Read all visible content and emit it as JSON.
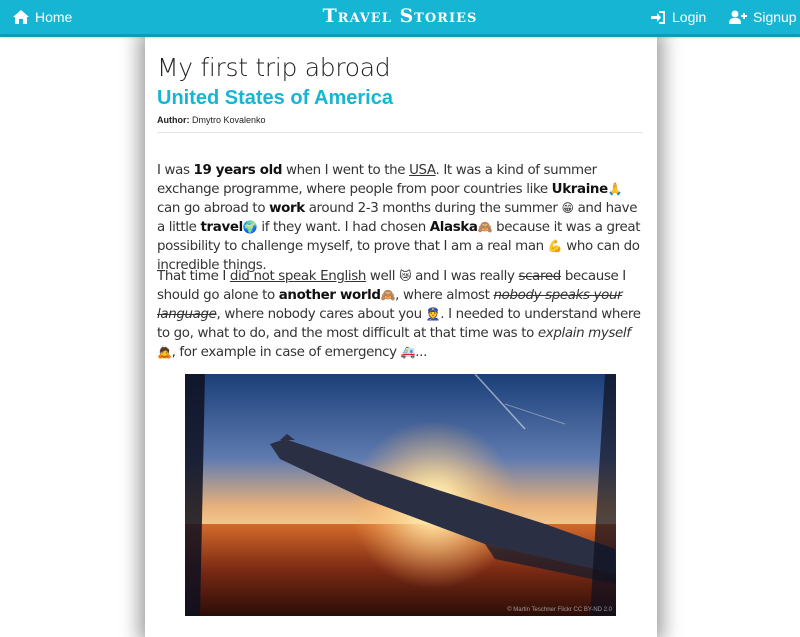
{
  "navbar": {
    "home_label": "Home",
    "brand": "Travel Stories",
    "login_label": "Login",
    "signup_label": "Signup",
    "accent_color": "#17b5d4"
  },
  "article": {
    "title": "My first trip abroad",
    "country": "United States of America",
    "author_label": "Author:",
    "author_name": "Dmytro Kovalenko",
    "paragraph1": {
      "t1": "I was ",
      "b_years": "19 years old",
      "t2": " when I went to the ",
      "u_usa": "USA",
      "t3": ". It was a kind of summer exchange programme, where people from poor countries like ",
      "b_ukraine": "Ukraine",
      "e1": "🙏",
      "t4": " can go abroad to ",
      "b_work": "work",
      "t5": " around 2-3 months during the summer ",
      "e2": "😁",
      "t6": " and have a little ",
      "b_travel": "travel",
      "e3": "🌍",
      "t7": " if they want. I had chosen ",
      "b_alaska": "Alaska",
      "e4": "🙈",
      "t8": " because it was a great possibility to challenge myself, to prove that I am a real man ",
      "e5": "💪",
      "t9": " who can do incredible things."
    },
    "paragraph2": {
      "t1": "That time I ",
      "u_english": "did not speak English",
      "t2": " well ",
      "e1": "😿",
      "t3": " and I was really ",
      "s_scared": "scared",
      "t4": " because I should go alone to ",
      "b_world": "another world",
      "e2": "🙈",
      "t5": ", where almost ",
      "i_nobody": "nobody speaks your language",
      "t6": ", where nobody cares about you ",
      "e3": "👮",
      "t7": ". I needed to understand where to go, what to do, and the most difficult at that time was to ",
      "i_explain": "explain myself",
      "e4": "🙇",
      "t8": ", for example in case of emergency ",
      "e5": "🚑",
      "t9": "..."
    },
    "image": {
      "description_icon": "airplane-window-sunset-photo",
      "credit": "© Martin Teschner Flickr CC BY-ND 2.0"
    }
  }
}
